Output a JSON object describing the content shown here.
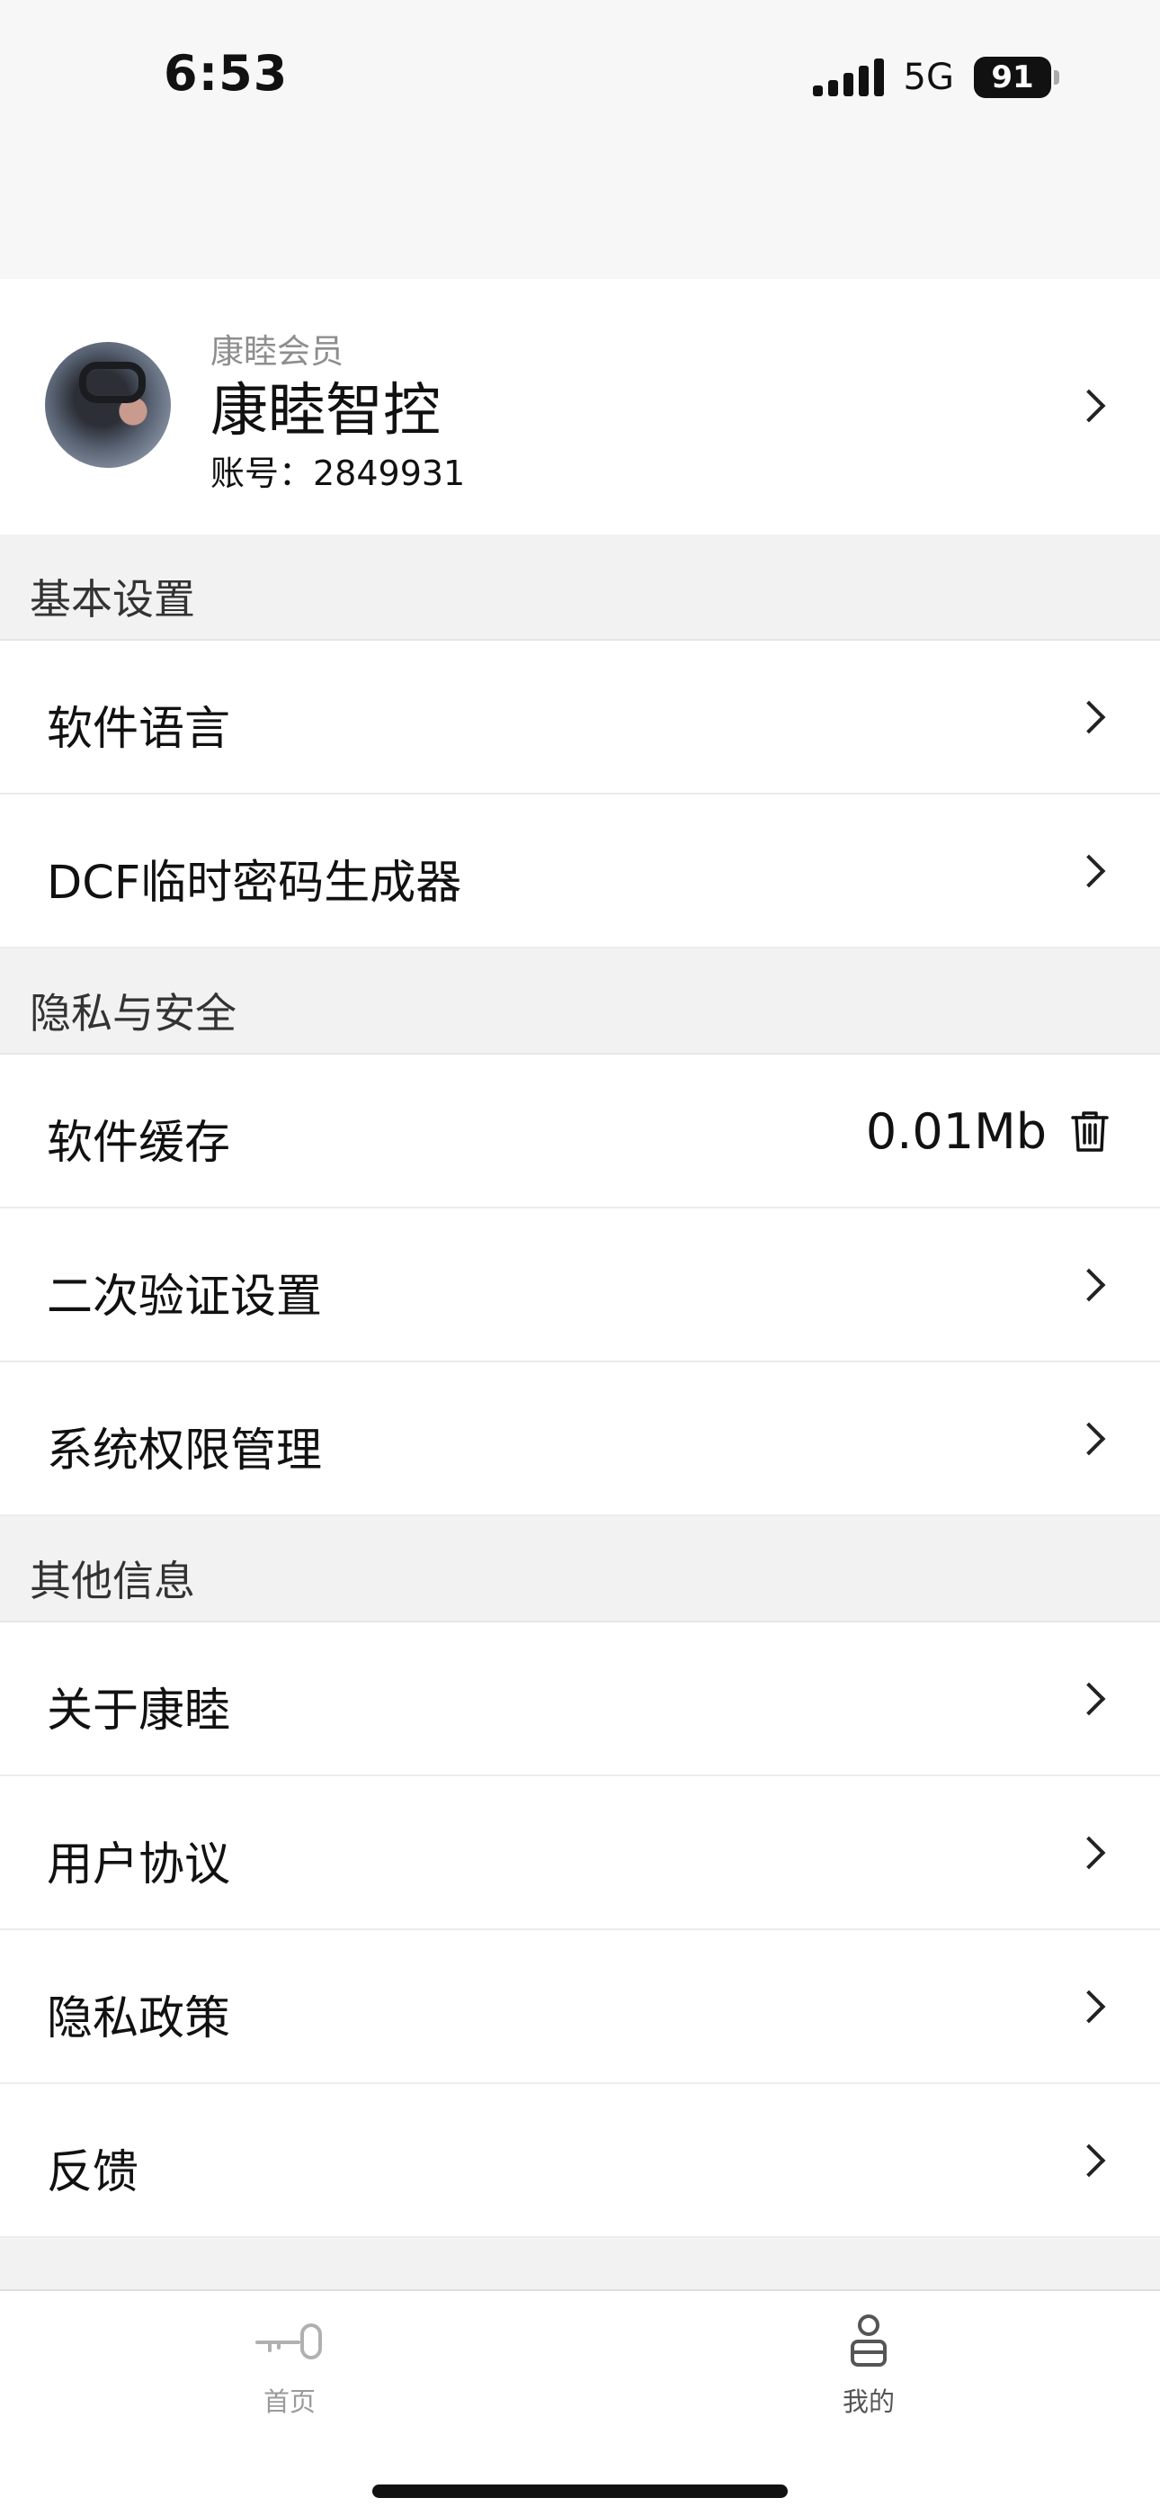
{
  "status_bar": {
    "time": "6:53",
    "network": "5G",
    "battery": "91",
    "icons": [
      "signal-icon",
      "battery-icon"
    ]
  },
  "profile": {
    "member_label": "康睦会员",
    "name": "康睦智控",
    "account": "账号：2849931",
    "icon": "chevron-right-icon"
  },
  "sections": {
    "basic": {
      "title": "基本设置",
      "items": [
        "软件语言",
        "DCF临时密码生成器"
      ]
    },
    "privacy": {
      "title": "隐私与安全",
      "cache": {
        "label": "软件缓存",
        "value": "0.01Mb",
        "icon": "trash-icon"
      },
      "items": [
        "二次验证设置",
        "系统权限管理"
      ]
    },
    "other": {
      "title": "其他信息",
      "items": [
        "关于康睦",
        "用户协议",
        "隐私政策",
        "反馈"
      ]
    }
  },
  "tab_bar": {
    "home": {
      "label": "首页",
      "icon": "key-icon",
      "active": false
    },
    "mine": {
      "label": "我的",
      "icon": "person-icon",
      "active": true
    }
  },
  "colors": {
    "background": "#f5f5f5",
    "section_header": "#f2f2f2",
    "text": "#111111",
    "muted": "#8e8e8e"
  }
}
